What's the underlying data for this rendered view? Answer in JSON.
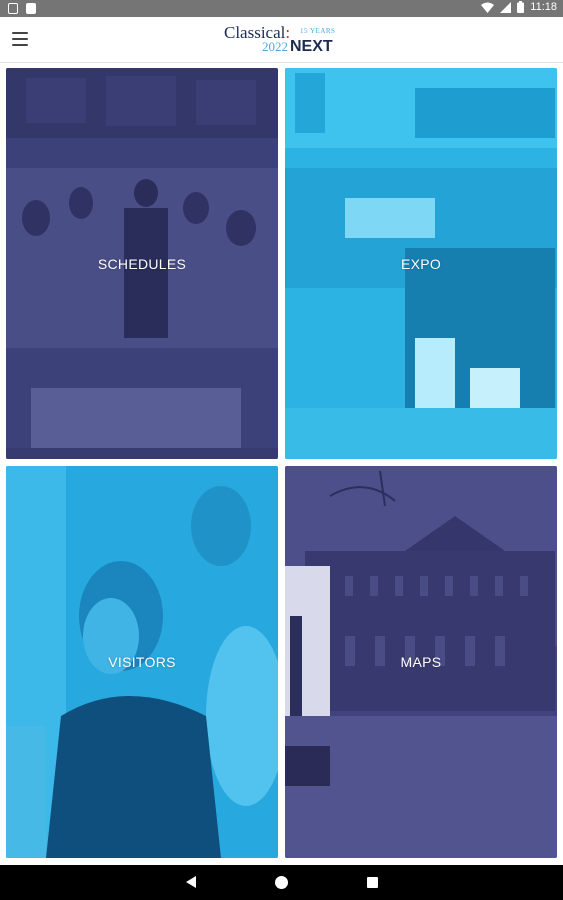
{
  "status_bar": {
    "time": "11:18",
    "icons": [
      "notification-square-icon",
      "notification-doc-icon",
      "wifi-icon",
      "signal-icon",
      "battery-icon"
    ]
  },
  "app_bar": {
    "menu_icon": "hamburger-menu-icon",
    "logo": {
      "classical": "Classical",
      "colon": ":",
      "years": "15 YEARS",
      "year": "2022",
      "next": "NEXT"
    }
  },
  "tiles": [
    {
      "label": "SCHEDULES",
      "tint": "#3d4179"
    },
    {
      "label": "EXPO",
      "tint": "#2db3e3"
    },
    {
      "label": "VISITORS",
      "tint": "#27a9df"
    },
    {
      "label": "MAPS",
      "tint": "#41427e"
    }
  ],
  "nav_bar": {
    "icons": [
      "back-icon",
      "home-icon",
      "recents-icon"
    ]
  }
}
